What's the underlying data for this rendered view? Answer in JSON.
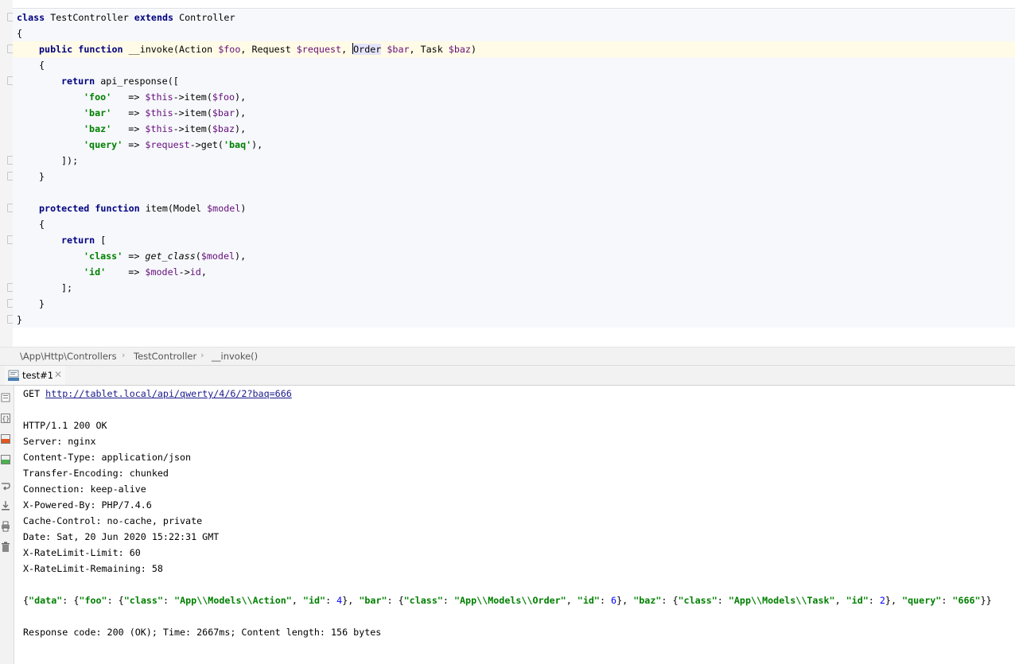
{
  "editor": {
    "class_kw": "class",
    "class_name": "TestController",
    "extends_kw": "extends",
    "parent_class": "Controller",
    "open_brace": "{",
    "close_brace": "}",
    "invoke": {
      "public_kw": "public",
      "function_kw": "function",
      "name": "__invoke(",
      "p1_type": "Action ",
      "p1_var": "$foo",
      "sep1": ", ",
      "p2_type": "Request ",
      "p2_var": "$request",
      "sep2": ", ",
      "p3_type": "Order",
      "p3_space": " ",
      "p3_var": "$bar",
      "sep3": ", ",
      "p4_type": "Task ",
      "p4_var": "$baz",
      "close": ")",
      "open_brace": "{",
      "return_kw": "return",
      "call": " api_response([",
      "rows": [
        {
          "key": "'foo'",
          "pad": "   => ",
          "var": "$this",
          "rest": "->item(",
          "arg": "$foo",
          "end": "),"
        },
        {
          "key": "'bar'",
          "pad": "   => ",
          "var": "$this",
          "rest": "->item(",
          "arg": "$bar",
          "end": "),"
        },
        {
          "key": "'baz'",
          "pad": "   => ",
          "var": "$this",
          "rest": "->item(",
          "arg": "$baz",
          "end": "),"
        }
      ],
      "query_key": "'query'",
      "query_arrow": " => ",
      "query_var": "$request",
      "query_rest": "->get(",
      "query_arg": "'baq'",
      "query_end": "),",
      "end_call": "]);",
      "close_brace": "}"
    },
    "item": {
      "protected_kw": "protected",
      "function_kw": "function",
      "name": " item(Model ",
      "param": "$model",
      "close": ")",
      "open_brace": "{",
      "return_kw": "return",
      "open_arr": " [",
      "class_key": "'class'",
      "class_arrow": " => ",
      "class_fn": "get_class",
      "class_open": "(",
      "class_var": "$model",
      "class_end": "),",
      "id_key": "'id'",
      "id_arrow": "    => ",
      "id_var": "$model",
      "id_rest": "->",
      "id_prop": "id",
      "id_end": ",",
      "close_arr": "];",
      "close_brace": "}"
    }
  },
  "breadcrumb": {
    "items": [
      "\\App\\Http\\Controllers",
      "TestController",
      "__invoke()"
    ],
    "separator": "›"
  },
  "tool_window": {
    "tab_label": "test#1",
    "tab_close": "✕",
    "tab_icon": "api-icon"
  },
  "output": {
    "method": "GET ",
    "url": "http://tablet.local/api/qwerty/4/6/2?baq=666",
    "status_line": "HTTP/1.1 200 OK",
    "headers": [
      "Server: nginx",
      "Content-Type: application/json",
      "Transfer-Encoding: chunked",
      "Connection: keep-alive",
      "X-Powered-By: PHP/7.4.6",
      "Cache-Control: no-cache, private",
      "Date: Sat, 20 Jun 2020 15:22:31 GMT",
      "X-RateLimit-Limit: 60",
      "X-RateLimit-Remaining: 58"
    ],
    "json": {
      "p1": "{",
      "k_data": "\"data\"",
      "p2": ": {",
      "k_foo": "\"foo\"",
      "p3": ": {",
      "k_class1": "\"class\"",
      "p4": ": ",
      "v_class1": "\"App\\\\Models\\\\Action\"",
      "p5": ", ",
      "k_id1": "\"id\"",
      "p6": ": ",
      "v_id1": "4",
      "p7": "}, ",
      "k_bar": "\"bar\"",
      "p8": ": {",
      "k_class2": "\"class\"",
      "p9": ": ",
      "v_class2": "\"App\\\\Models\\\\Order\"",
      "p10": ", ",
      "k_id2": "\"id\"",
      "p11": ": ",
      "v_id2": "6",
      "p12": "}, ",
      "k_baz": "\"baz\"",
      "p13": ": {",
      "k_class3": "\"class\"",
      "p14": ": ",
      "v_class3": "\"App\\\\Models\\\\Task\"",
      "p15": ", ",
      "k_id3": "\"id\"",
      "p16": ": ",
      "v_id3": "2",
      "p17": "}, ",
      "k_query": "\"query\"",
      "p18": ": ",
      "v_query": "\"666\"",
      "p19": "}}"
    },
    "summary": "Response code: 200 (OK); Time: 2667ms; Content length: 156 bytes"
  },
  "colors": {
    "keyword": "#000080",
    "variable": "#660e7a",
    "string": "#008000",
    "number": "#0000ff",
    "current_line": "#fffbe6",
    "editor_bg": "#f6f8fb"
  }
}
